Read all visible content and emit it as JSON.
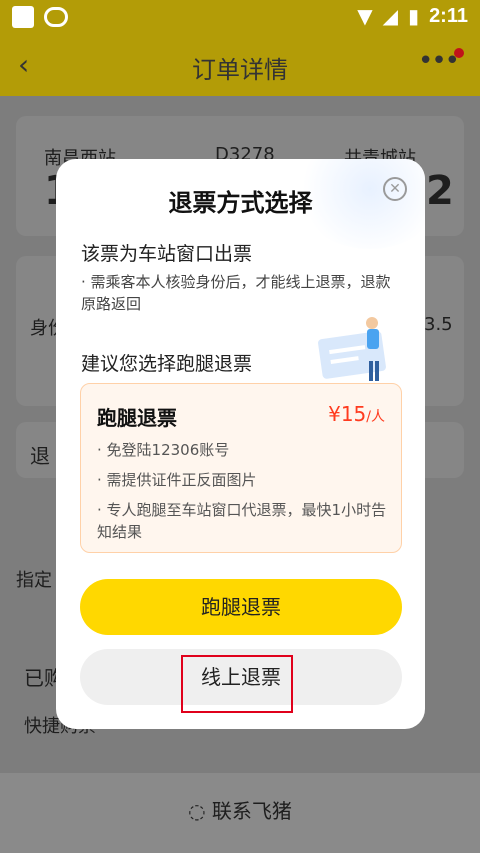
{
  "status_bar": {
    "time": "2:11"
  },
  "header": {
    "title": "订单详情"
  },
  "background": {
    "from_station": "南昌西站",
    "train_no": "D3278",
    "to_station": "共青城站",
    "from_big": "1",
    "to_big": "2",
    "row_left": "身份",
    "row_right": "3.5",
    "refund_left": "退",
    "assign_text": "指定",
    "bought_text": "已购",
    "quick_text": "快捷购票",
    "footer_label": "联系飞猪"
  },
  "modal": {
    "title": "退票方式选择",
    "window_title": "该票为车站窗口出票",
    "window_desc": "· 需乘客本人核验身份后，才能线上退票，退款原路返回",
    "suggest_title": "建议您选择跑腿退票",
    "option": {
      "name": "跑腿退票",
      "price": "¥15",
      "unit": "/人",
      "points": [
        "· 免登陆12306账号",
        "· 需提供证件正反面图片",
        "· 专人跑腿至车站窗口代退票，最快1小时告知结果"
      ]
    },
    "primary_button": "跑腿退票",
    "secondary_button": "线上退票"
  }
}
